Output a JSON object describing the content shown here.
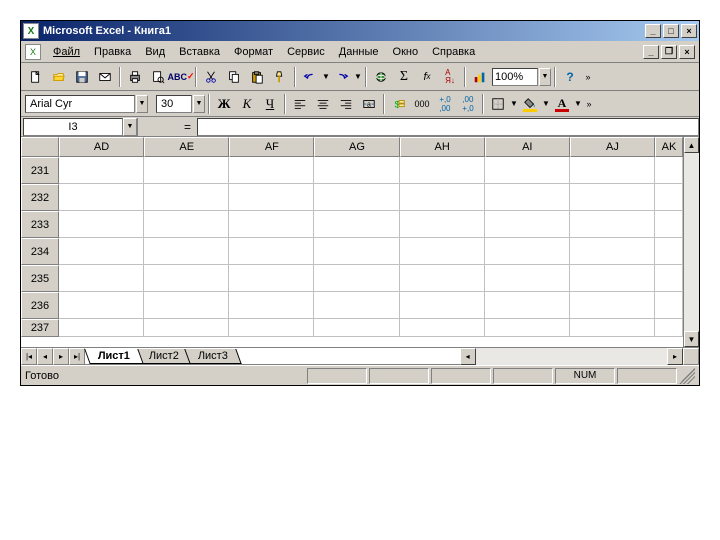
{
  "title": "Microsoft Excel - Книга1",
  "menu": [
    "Файл",
    "Правка",
    "Вид",
    "Вставка",
    "Формат",
    "Сервис",
    "Данные",
    "Окно",
    "Справка"
  ],
  "toolbar": {
    "zoom": "100%"
  },
  "format": {
    "font": "Arial Cyr",
    "size": "30",
    "bold": "Ж",
    "italic": "К",
    "underline": "Ч"
  },
  "formula": {
    "cellref": "I3",
    "eq": "="
  },
  "columns": [
    "AD",
    "AE",
    "AF",
    "AG",
    "AH",
    "AI",
    "AJ",
    "AK"
  ],
  "rows": [
    "231",
    "232",
    "233",
    "234",
    "235",
    "236",
    "237"
  ],
  "sheets": [
    "Лист1",
    "Лист2",
    "Лист3"
  ],
  "active_sheet": 0,
  "status": {
    "ready": "Готово",
    "num": "NUM"
  }
}
